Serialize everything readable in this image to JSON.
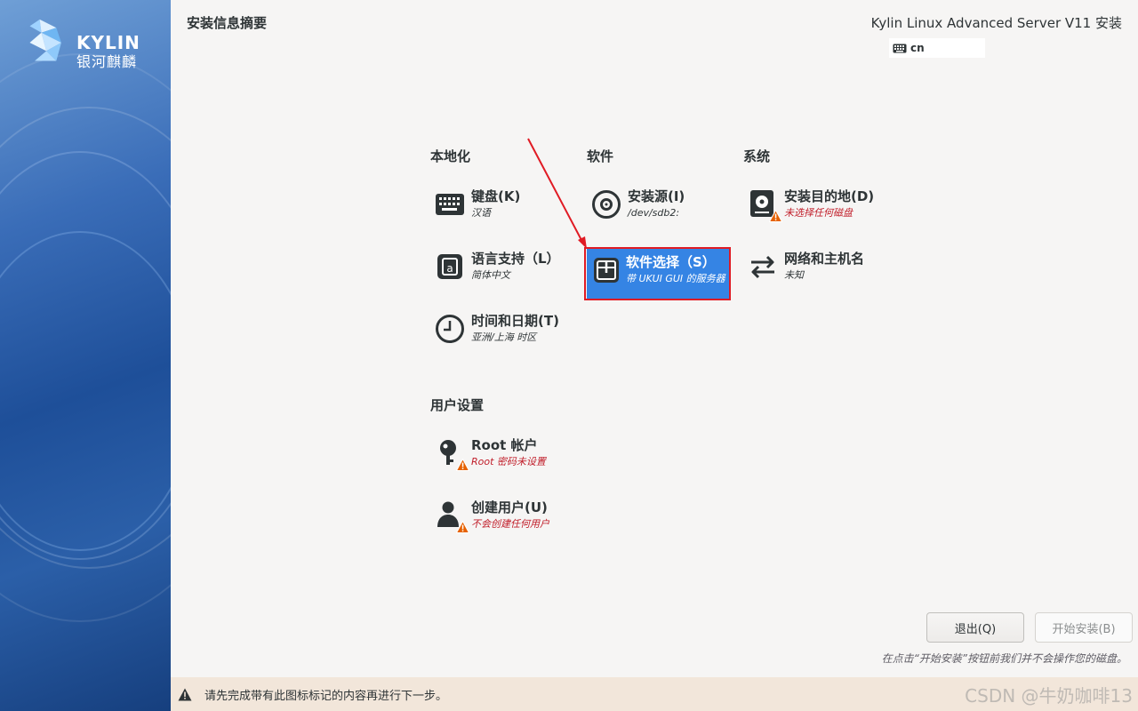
{
  "header": {
    "page_title": "安装信息摘要",
    "product_title": "Kylin Linux Advanced Server V11 安装",
    "keyboard_layout": "cn"
  },
  "logo": {
    "text": "KYLIN",
    "subtext": "银河麒麟"
  },
  "sections": {
    "localization": {
      "title": "本地化",
      "keyboard": {
        "label": "键盘(K)",
        "status": "汉语",
        "icon": "keyboard-icon"
      },
      "language": {
        "label": "语言支持（L）",
        "status": "简体中文",
        "icon": "language-icon"
      },
      "datetime": {
        "label": "时间和日期(T)",
        "status": "亚洲/上海 时区",
        "icon": "clock-icon"
      }
    },
    "software": {
      "title": "软件",
      "source": {
        "label": "安装源(I)",
        "status": "/dev/sdb2:",
        "icon": "disc-icon"
      },
      "selection": {
        "label": "软件选择（S）",
        "status": "带 UKUI GUI 的服务器",
        "icon": "package-icon"
      }
    },
    "system": {
      "title": "系统",
      "destination": {
        "label": "安装目的地(D)",
        "status": "未选择任何磁盘",
        "icon": "disk-icon"
      },
      "network": {
        "label": "网络和主机名",
        "status": "未知",
        "icon": "network-icon"
      }
    },
    "user": {
      "title": "用户设置",
      "root": {
        "label": "Root 帐户",
        "status": "Root 密码未设置",
        "icon": "root-icon"
      },
      "create_user": {
        "label": "创建用户(U)",
        "status": "不会创建任何用户",
        "icon": "user-icon"
      }
    }
  },
  "buttons": {
    "quit": "退出(Q)",
    "begin": "开始安装(B)"
  },
  "footnote": "在点击“开始安装”按钮前我们并不会操作您的磁盘。",
  "warning_bar": "请先完成带有此图标标记的内容再进行下一步。",
  "watermark": "CSDN @牛奶咖啡13",
  "colors": {
    "accent": "#3584e4",
    "warning": "#c01c28",
    "highlight": "#e01b24"
  }
}
